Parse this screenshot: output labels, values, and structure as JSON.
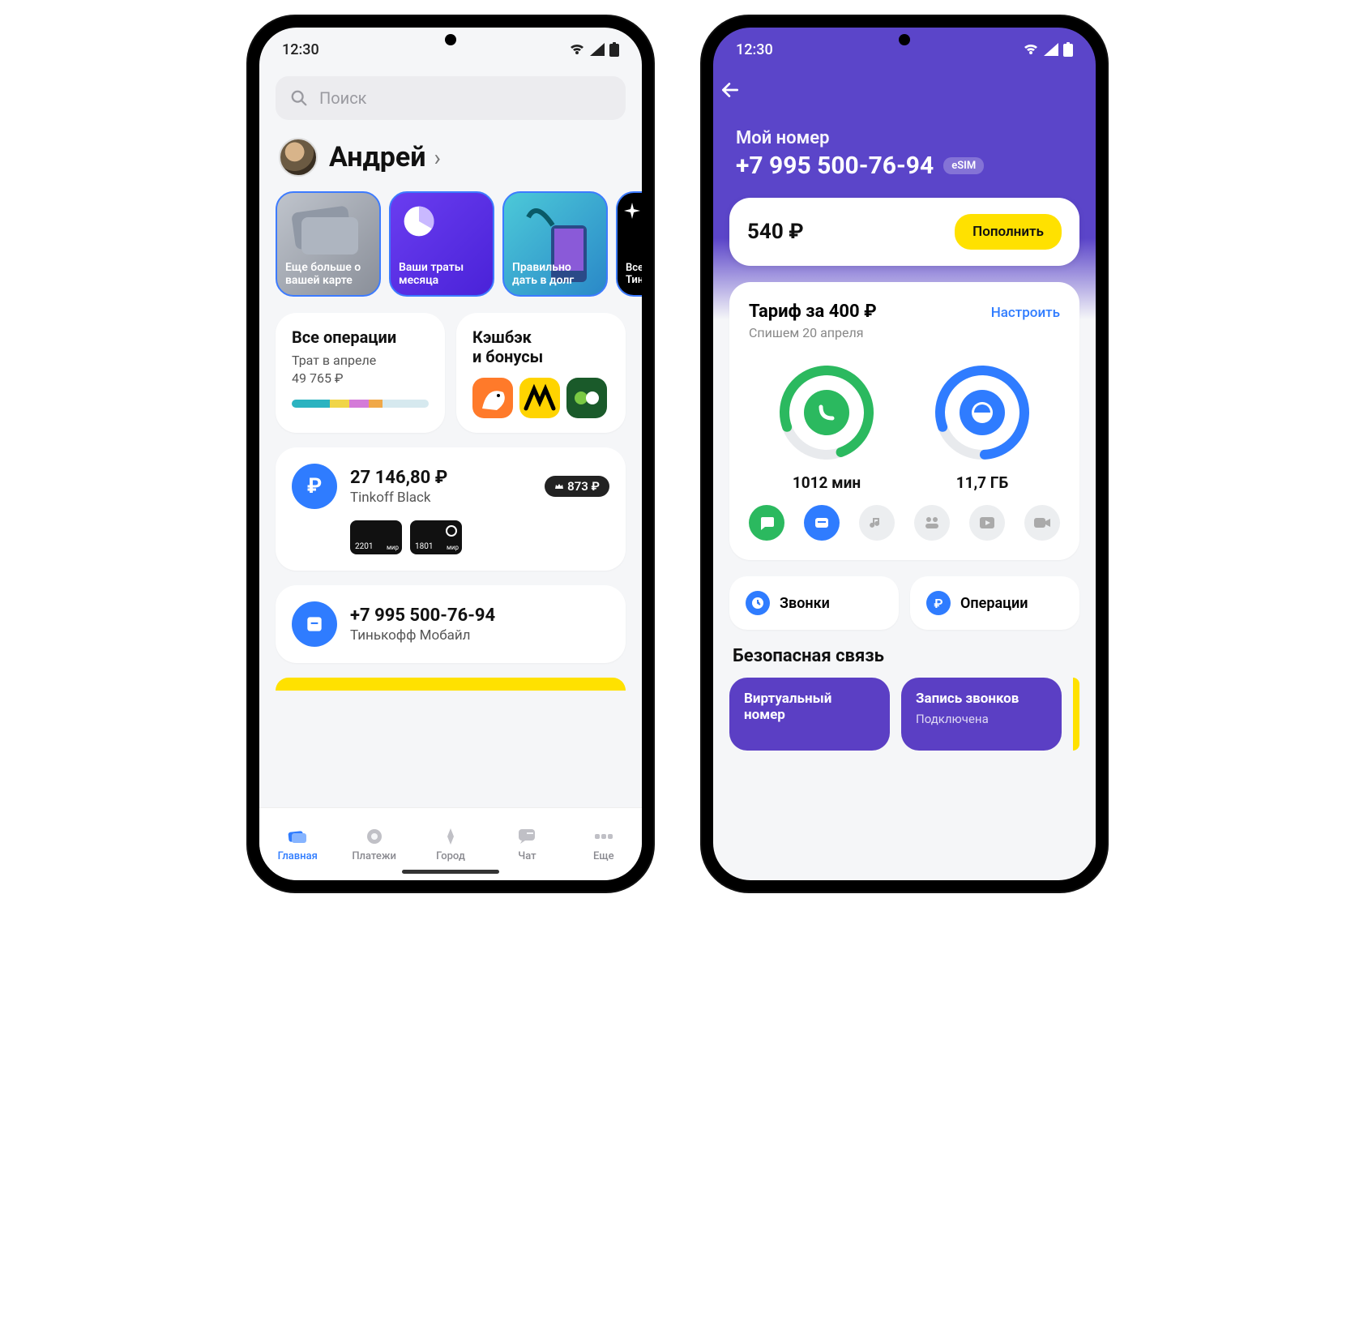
{
  "status": {
    "time": "12:30"
  },
  "left": {
    "search": {
      "placeholder": "Поиск"
    },
    "profile": {
      "name": "Андрей"
    },
    "stories": {
      "s1": "Еще больше о вашей карте",
      "s2": "Ваши траты месяца",
      "s3": "Правильно дать в долг",
      "s4": "Всел\nТинь"
    },
    "ops": {
      "title": "Все операции",
      "sub1": "Трат в апреле",
      "sub2": "49 765 ₽",
      "segments": [
        {
          "w": 28,
          "c": "#2bb3c0"
        },
        {
          "w": 14,
          "c": "#f0d548"
        },
        {
          "w": 14,
          "c": "#d47bd8"
        },
        {
          "w": 10,
          "c": "#f0a848"
        },
        {
          "w": 34,
          "c": "#d6e9ef"
        }
      ]
    },
    "cashback": {
      "title": "Кэшбэк\nи бонусы"
    },
    "account": {
      "balance": "27 146,80 ₽",
      "name": "Tinkoff Black",
      "badge": "873 ₽",
      "card1": "2201",
      "card2": "1801"
    },
    "mobile": {
      "number": "+7 995 500-76-94",
      "name": "Тинькофф Мобайл"
    },
    "nav": {
      "home": "Главная",
      "payments": "Платежи",
      "city": "Город",
      "chat": "Чат",
      "more": "Еще"
    }
  },
  "right": {
    "header": {
      "label": "Мой номер",
      "number": "+7 995 500-76-94",
      "esim": "eSIM"
    },
    "balance": {
      "amount": "540 ₽",
      "button": "Пополнить"
    },
    "tariff": {
      "title": "Тариф за 400 ₽",
      "link": "Настроить",
      "sub": "Спишем 20 апреля",
      "minutes": "1012 мин",
      "gb": "11,7 ГБ"
    },
    "actions": {
      "calls": "Звонки",
      "ops": "Операции"
    },
    "safety": {
      "title": "Безопасная связь",
      "card1_title": "Виртуальный номер",
      "card2_title": "Запись звонков",
      "card2_sub": "Подключена"
    }
  }
}
